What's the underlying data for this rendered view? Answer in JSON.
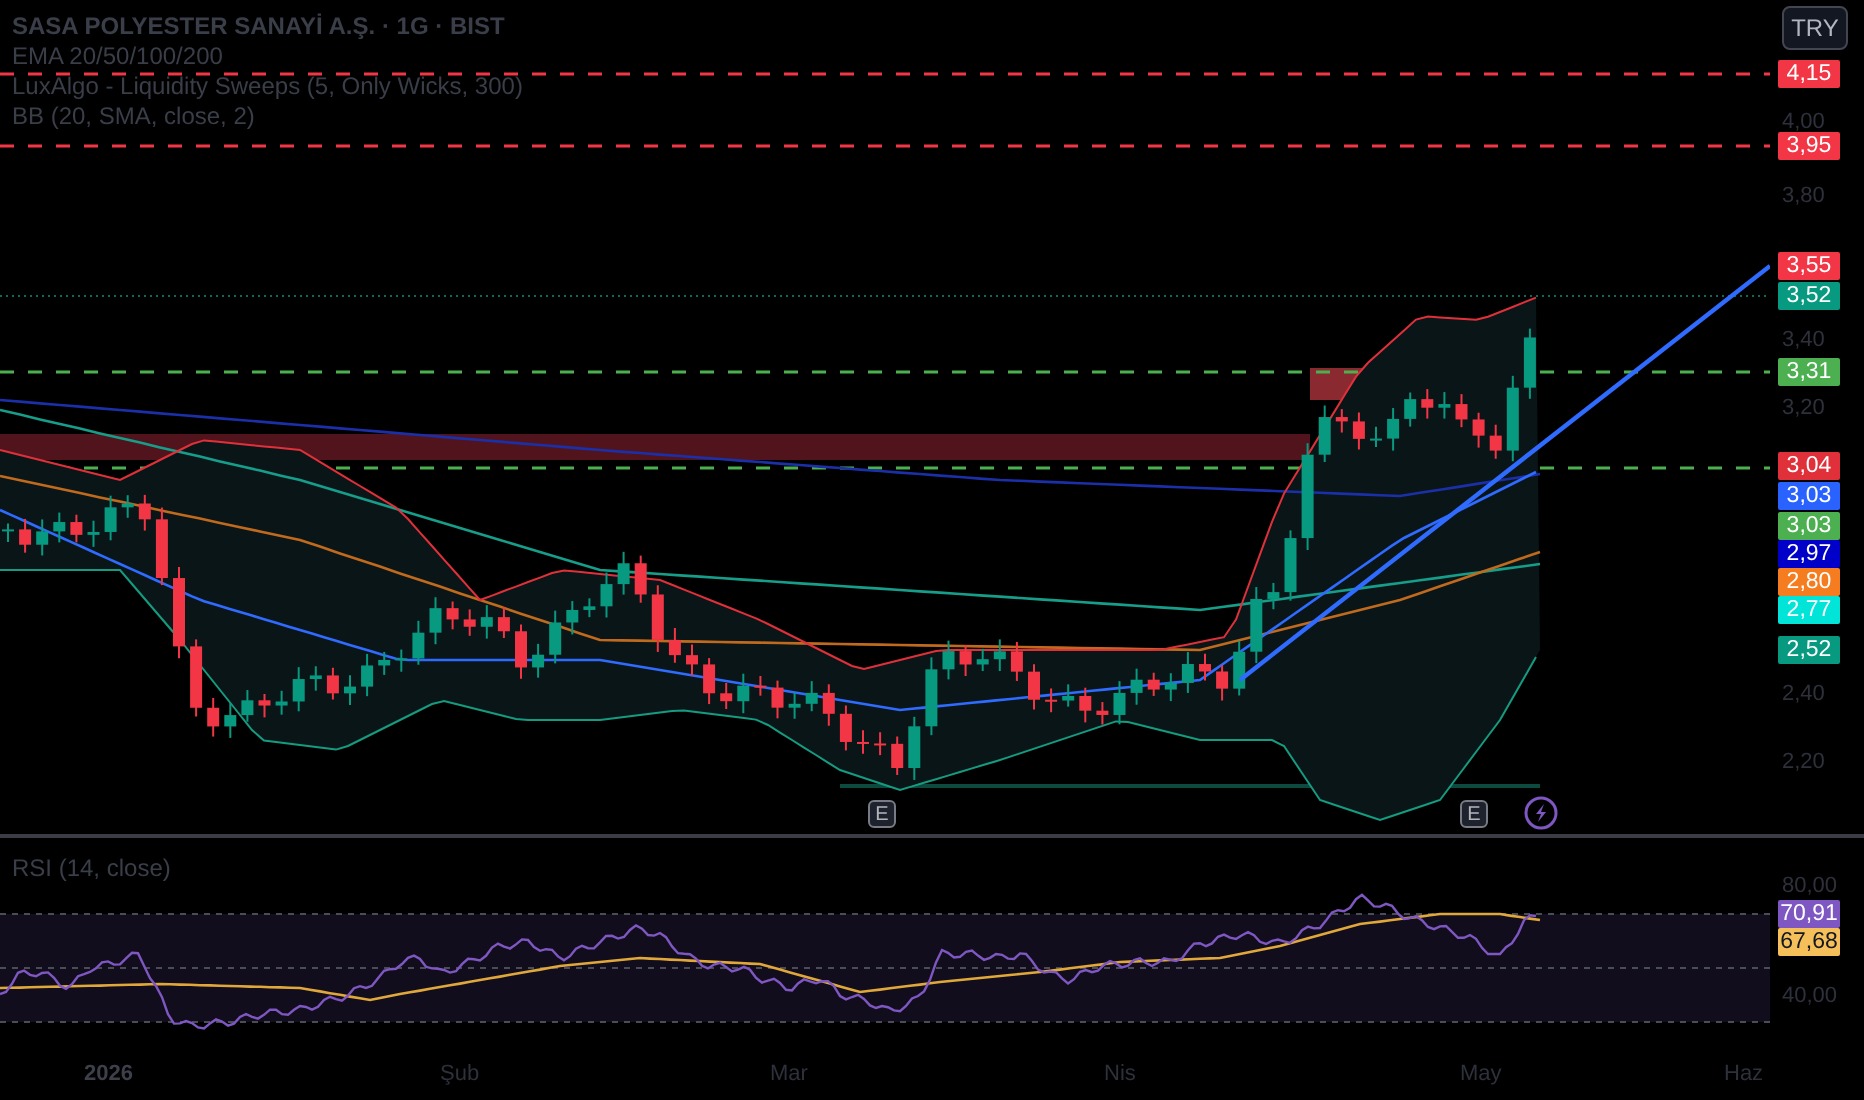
{
  "header": {
    "title": "SASA POLYESTER SANAYİ A.Ş. · 1G · BIST",
    "indicators": [
      "EMA 20/50/100/200",
      "LuxAlgo - Liquidity Sweeps (5, Only Wicks, 300)",
      "BB (20, SMA, close, 2)"
    ]
  },
  "currency_button": "TRY",
  "price_scale": {
    "ticks": [
      "4,00",
      "3,80",
      "3,40",
      "3,20",
      "2,40",
      "2,20"
    ],
    "badges": [
      {
        "text": "4,15",
        "color": "#f23645"
      },
      {
        "text": "3,95",
        "color": "#f23645"
      },
      {
        "text": "3,55",
        "color": "#f23645"
      },
      {
        "text": "3,52",
        "color": "#089981"
      },
      {
        "text": "3,31",
        "color": "#4caf50"
      },
      {
        "text": "3,04",
        "color": "#e0303a"
      },
      {
        "text": "3,03",
        "color": "#2962ff"
      },
      {
        "text": "3,03",
        "color": "#4caf50"
      },
      {
        "text": "2,97",
        "color": "#0000c8"
      },
      {
        "text": "2,80",
        "color": "#f57c1f"
      },
      {
        "text": "2,77",
        "color": "#00e5d8"
      },
      {
        "text": "2,52",
        "color": "#089981"
      }
    ]
  },
  "events": [
    {
      "kind": "earnings",
      "label": "E"
    },
    {
      "kind": "earnings",
      "label": "E"
    },
    {
      "kind": "lightning"
    }
  ],
  "rsi": {
    "title": "RSI (14, close)",
    "ticks": [
      "80,00",
      "40,00"
    ],
    "badges": [
      {
        "text": "70,91",
        "color": "#7e57c2"
      },
      {
        "text": "67,68",
        "color": "#f5c05a"
      }
    ]
  },
  "time_axis": [
    {
      "label": "2026",
      "kind": "year"
    },
    {
      "label": "Şub",
      "kind": "month"
    },
    {
      "label": "Mar",
      "kind": "month"
    },
    {
      "label": "Nis",
      "kind": "month"
    },
    {
      "label": "May",
      "kind": "month"
    },
    {
      "label": "Haz",
      "kind": "month"
    }
  ]
}
